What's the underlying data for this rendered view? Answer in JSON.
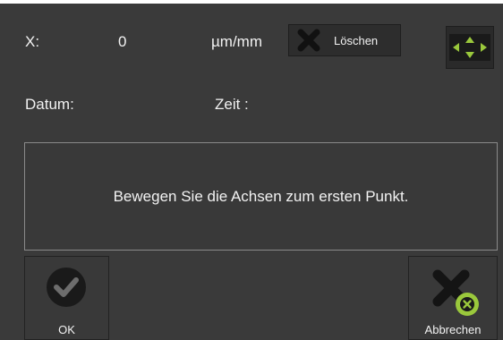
{
  "header": {
    "x_label": "X:",
    "x_value": "0",
    "x_unit": "µm/mm",
    "clear_label": "Löschen",
    "date_label": "Datum:",
    "time_label": "Zeit :"
  },
  "message": "Bewegen Sie die Achsen zum ersten Punkt.",
  "buttons": {
    "ok_label": "OK",
    "cancel_label": "Abbrechen"
  },
  "icons": {
    "clear": "x-icon",
    "move": "move-axes-icon",
    "ok": "checkmark-circle-icon",
    "cancel": "x-with-green-badge-icon"
  },
  "colors": {
    "background": "#3a3a3a",
    "accent_green": "#9ac83c",
    "icon_dark": "#1a1a1a"
  }
}
